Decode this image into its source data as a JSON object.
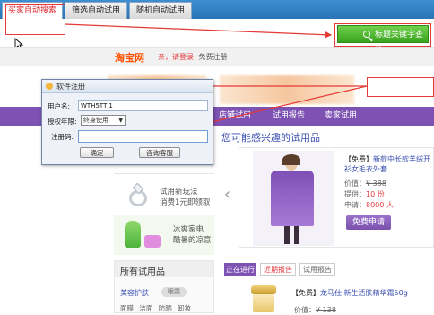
{
  "tabs": [
    {
      "label": "买家自动搜索"
    },
    {
      "label": "筛选自动试用"
    },
    {
      "label": "随机自动试用"
    }
  ],
  "find_button": {
    "label": "标题关键字查找"
  },
  "site": {
    "logo": "淘宝网",
    "greeting_prefix": "亲，",
    "login": "请登录",
    "register": "免费注册"
  },
  "nav": [
    "店铺试用",
    "试用报告",
    "卖家试用"
  ],
  "main": {
    "section_title": "您可能感兴趣的试用品",
    "product": {
      "tag": "【免费】",
      "name": "新款中长款羊绒开衫女毛衣外套",
      "price_label": "价值：",
      "price": "¥ 388",
      "supply_label": "提供：",
      "supply": "10 份",
      "apply_label": "申请：",
      "apply": "8000 人",
      "apply_button": "免费申请"
    },
    "list_tabs": [
      "正在进行",
      "近期报告",
      "试用报告"
    ],
    "product2": {
      "tag": "【免费】",
      "name": "龙马仕 新生活肤精华霜50g",
      "price_label": "价值：",
      "price": "¥ 138"
    }
  },
  "sidebar": {
    "promo1_line1": "试用新玩法",
    "promo1_line2": "消费1元即领取",
    "promo2_line1": "冰爽家电",
    "promo2_line2": "酷暑的凉意",
    "all_title": "所有试用品",
    "cat_label": "美容护肤",
    "cat_pill": "眼霜",
    "subcats": [
      "面膜",
      "洁面",
      "防晒",
      "卸妆"
    ]
  },
  "dialog": {
    "title": "软件注册",
    "username_label": "用户名:",
    "username_value": "WTH5TTJ1",
    "period_label": "授权年限:",
    "period_value": "终身使用",
    "code_label": "注册码:",
    "confirm": "确定",
    "consult": "咨询客服"
  },
  "colors": {
    "purple_nav": "#7d52b3",
    "green_button": "#3aa320",
    "annotation_red": "#e53935",
    "tab_blue": "#2a73b6"
  }
}
